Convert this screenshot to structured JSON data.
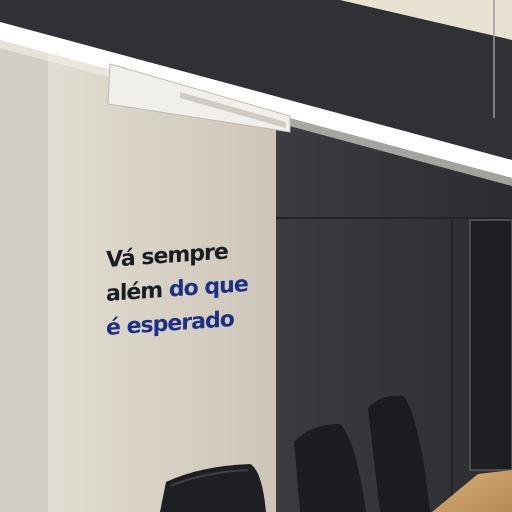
{
  "scene": {
    "description_colors": {
      "left_wall": "#d9d3c6",
      "side_wall": "#cfc9bb",
      "dark_panels": "#34363a",
      "ceiling": "#e9e3d3",
      "light_strip": "#ffffff",
      "table_wood": "#c9a066",
      "chair": "#1d1f23"
    }
  },
  "wall_text": {
    "line1_a": "Vá",
    "line1_b": "sempre",
    "line2_a": "além",
    "line2_b": "do que",
    "line3": "é esperado",
    "primary_color": "#1a1d22",
    "accent_color": "#1e2f86"
  }
}
